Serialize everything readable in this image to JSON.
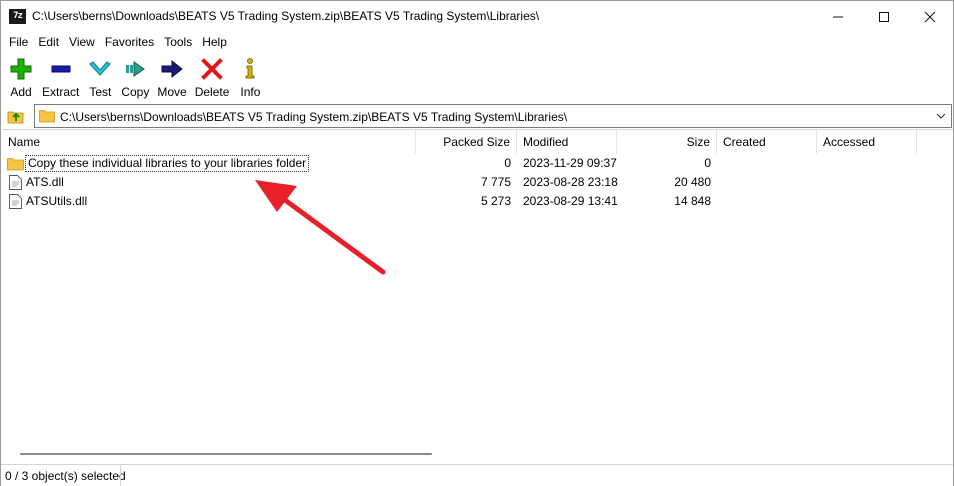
{
  "window": {
    "title": "C:\\Users\\berns\\Downloads\\BEATS V5 Trading System.zip\\BEATS V5 Trading System\\Libraries\\",
    "app_icon_text": "7z"
  },
  "menu": [
    "File",
    "Edit",
    "View",
    "Favorites",
    "Tools",
    "Help"
  ],
  "toolbar": [
    {
      "label": "Add",
      "icon": "plus-icon",
      "color": "#1db000"
    },
    {
      "label": "Extract",
      "icon": "minus-icon",
      "color": "#1a1aa8"
    },
    {
      "label": "Test",
      "icon": "check-icon",
      "color": "#1fc8d8"
    },
    {
      "label": "Copy",
      "icon": "copy-arrow-icon",
      "color": "#2a9d8f"
    },
    {
      "label": "Move",
      "icon": "move-arrow-icon",
      "color": "#1a1a7a"
    },
    {
      "label": "Delete",
      "icon": "delete-x-icon",
      "color": "#e01818"
    },
    {
      "label": "Info",
      "icon": "info-icon",
      "color": "#d8b000"
    }
  ],
  "address": {
    "path": "C:\\Users\\berns\\Downloads\\BEATS V5 Trading System.zip\\BEATS V5 Trading System\\Libraries\\"
  },
  "columns": [
    "Name",
    "Packed Size",
    "Modified",
    "Size",
    "Created",
    "Accessed"
  ],
  "files": [
    {
      "name": "Copy these individual libraries to your libraries folder",
      "type": "folder",
      "packed": "0",
      "modified": "2023-11-29 09:37",
      "size": "0",
      "created": "",
      "accessed": ""
    },
    {
      "name": "ATS.dll",
      "type": "file",
      "packed": "7 775",
      "modified": "2023-08-28 23:18",
      "size": "20 480",
      "created": "",
      "accessed": ""
    },
    {
      "name": "ATSUtils.dll",
      "type": "file",
      "packed": "5 273",
      "modified": "2023-08-29 13:41",
      "size": "14 848",
      "created": "",
      "accessed": ""
    }
  ],
  "status": {
    "selection": "0 / 3 object(s) selected"
  },
  "colors": {
    "annotation_arrow": "#e8202a",
    "folder": "#f5c542"
  }
}
